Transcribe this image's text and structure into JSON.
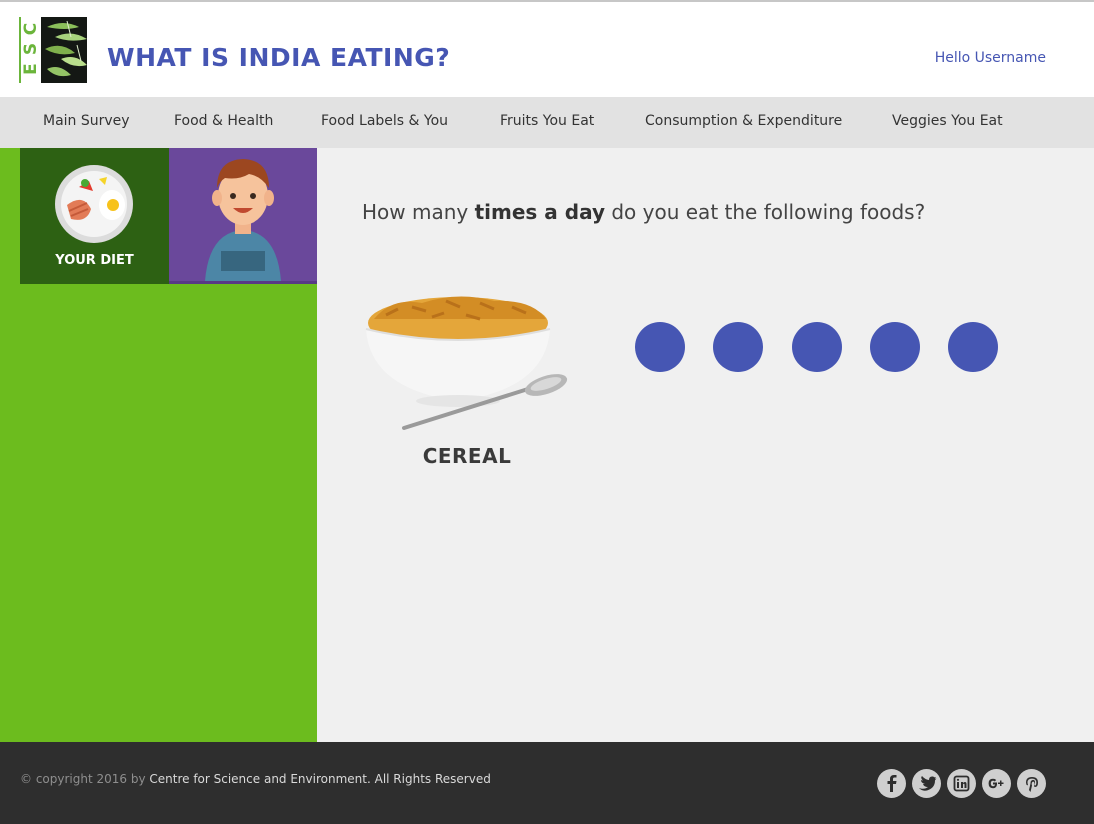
{
  "header": {
    "logo_letters": [
      "C",
      "S",
      "E"
    ],
    "site_title": "WHAT IS INDIA EATING?",
    "user_greeting": "Hello Username"
  },
  "nav": {
    "items": [
      {
        "label": "Main Survey"
      },
      {
        "label": "Food & Health"
      },
      {
        "label": "Food Labels & You"
      },
      {
        "label": "Fruits You Eat"
      },
      {
        "label": "Consumption & Expenditure"
      },
      {
        "label": "Veggies You Eat"
      }
    ]
  },
  "sidebar": {
    "diet_tile_label": "YOUR DIET"
  },
  "question": {
    "prefix": "How many ",
    "emphasis": "times a day",
    "suffix": " do you eat the following foods?"
  },
  "food": {
    "label": "CEREAL"
  },
  "options": {
    "count": 5,
    "color": "#4656b3"
  },
  "footer": {
    "copyright_prefix": "© copyright 2016 by ",
    "copyright_org": "Centre for Science and Environment. All Rights Reserved",
    "social_icons": [
      "facebook-icon",
      "twitter-icon",
      "linkedin-icon",
      "google-plus-icon",
      "pinterest-icon"
    ]
  },
  "colors": {
    "brand_blue": "#4656b3",
    "sidebar_green": "#6cbc1e",
    "diet_tile_green": "#2d6113",
    "avatar_purple": "#6a489b",
    "footer_dark": "#2e2e2e"
  }
}
